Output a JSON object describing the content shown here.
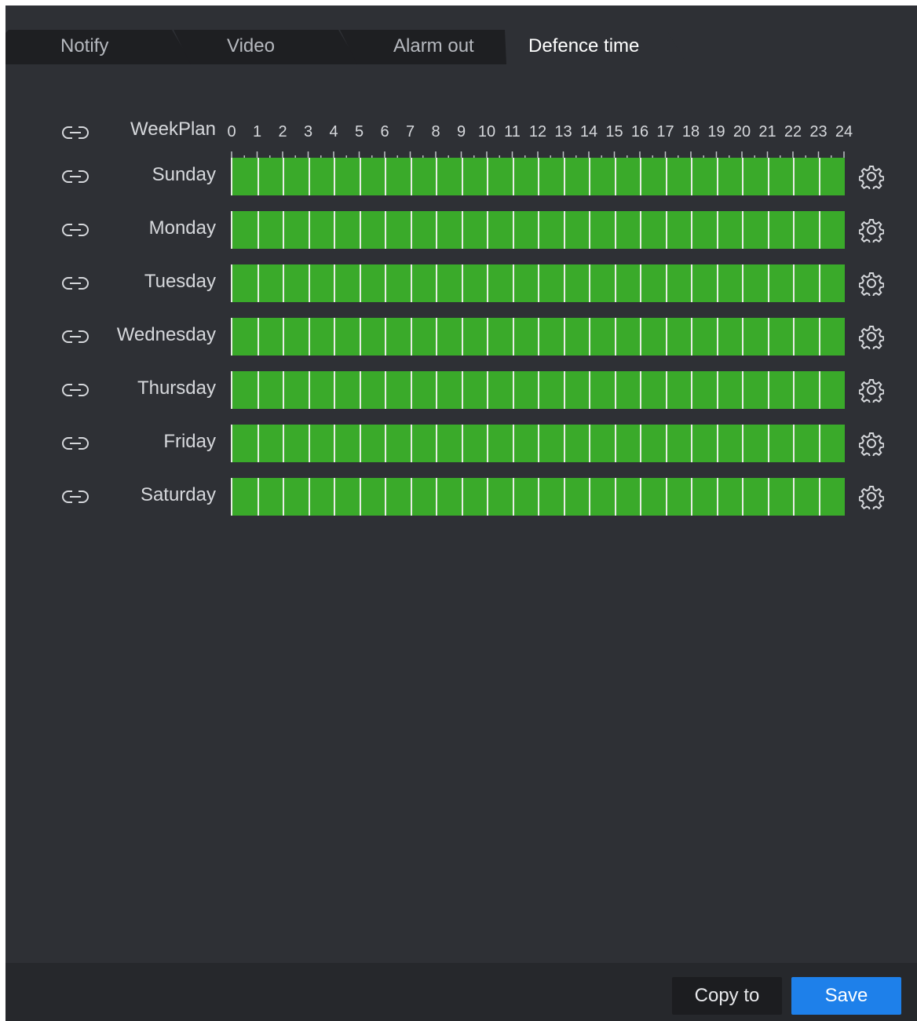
{
  "tabs": [
    {
      "label": "Notify",
      "active": false
    },
    {
      "label": "Video",
      "active": false
    },
    {
      "label": "Alarm out",
      "active": false
    },
    {
      "label": "Defence time",
      "active": true
    }
  ],
  "schedule": {
    "header_label": "WeekPlan",
    "hours": [
      "0",
      "1",
      "2",
      "3",
      "4",
      "5",
      "6",
      "7",
      "8",
      "9",
      "10",
      "11",
      "12",
      "13",
      "14",
      "15",
      "16",
      "17",
      "18",
      "19",
      "20",
      "21",
      "22",
      "23",
      "24"
    ],
    "days": [
      {
        "label": "Sunday",
        "armed_fraction": 1.0
      },
      {
        "label": "Monday",
        "armed_fraction": 1.0
      },
      {
        "label": "Tuesday",
        "armed_fraction": 1.0
      },
      {
        "label": "Wednesday",
        "armed_fraction": 1.0
      },
      {
        "label": "Thursday",
        "armed_fraction": 1.0
      },
      {
        "label": "Friday",
        "armed_fraction": 1.0
      },
      {
        "label": "Saturday",
        "armed_fraction": 1.0
      }
    ],
    "armed_color": "#3aaa2a"
  },
  "footer": {
    "copy_label": "Copy to",
    "save_label": "Save",
    "save_color": "#1e80ea"
  },
  "icons": {
    "row_link": "link-icon",
    "row_settings": "gear-icon"
  }
}
